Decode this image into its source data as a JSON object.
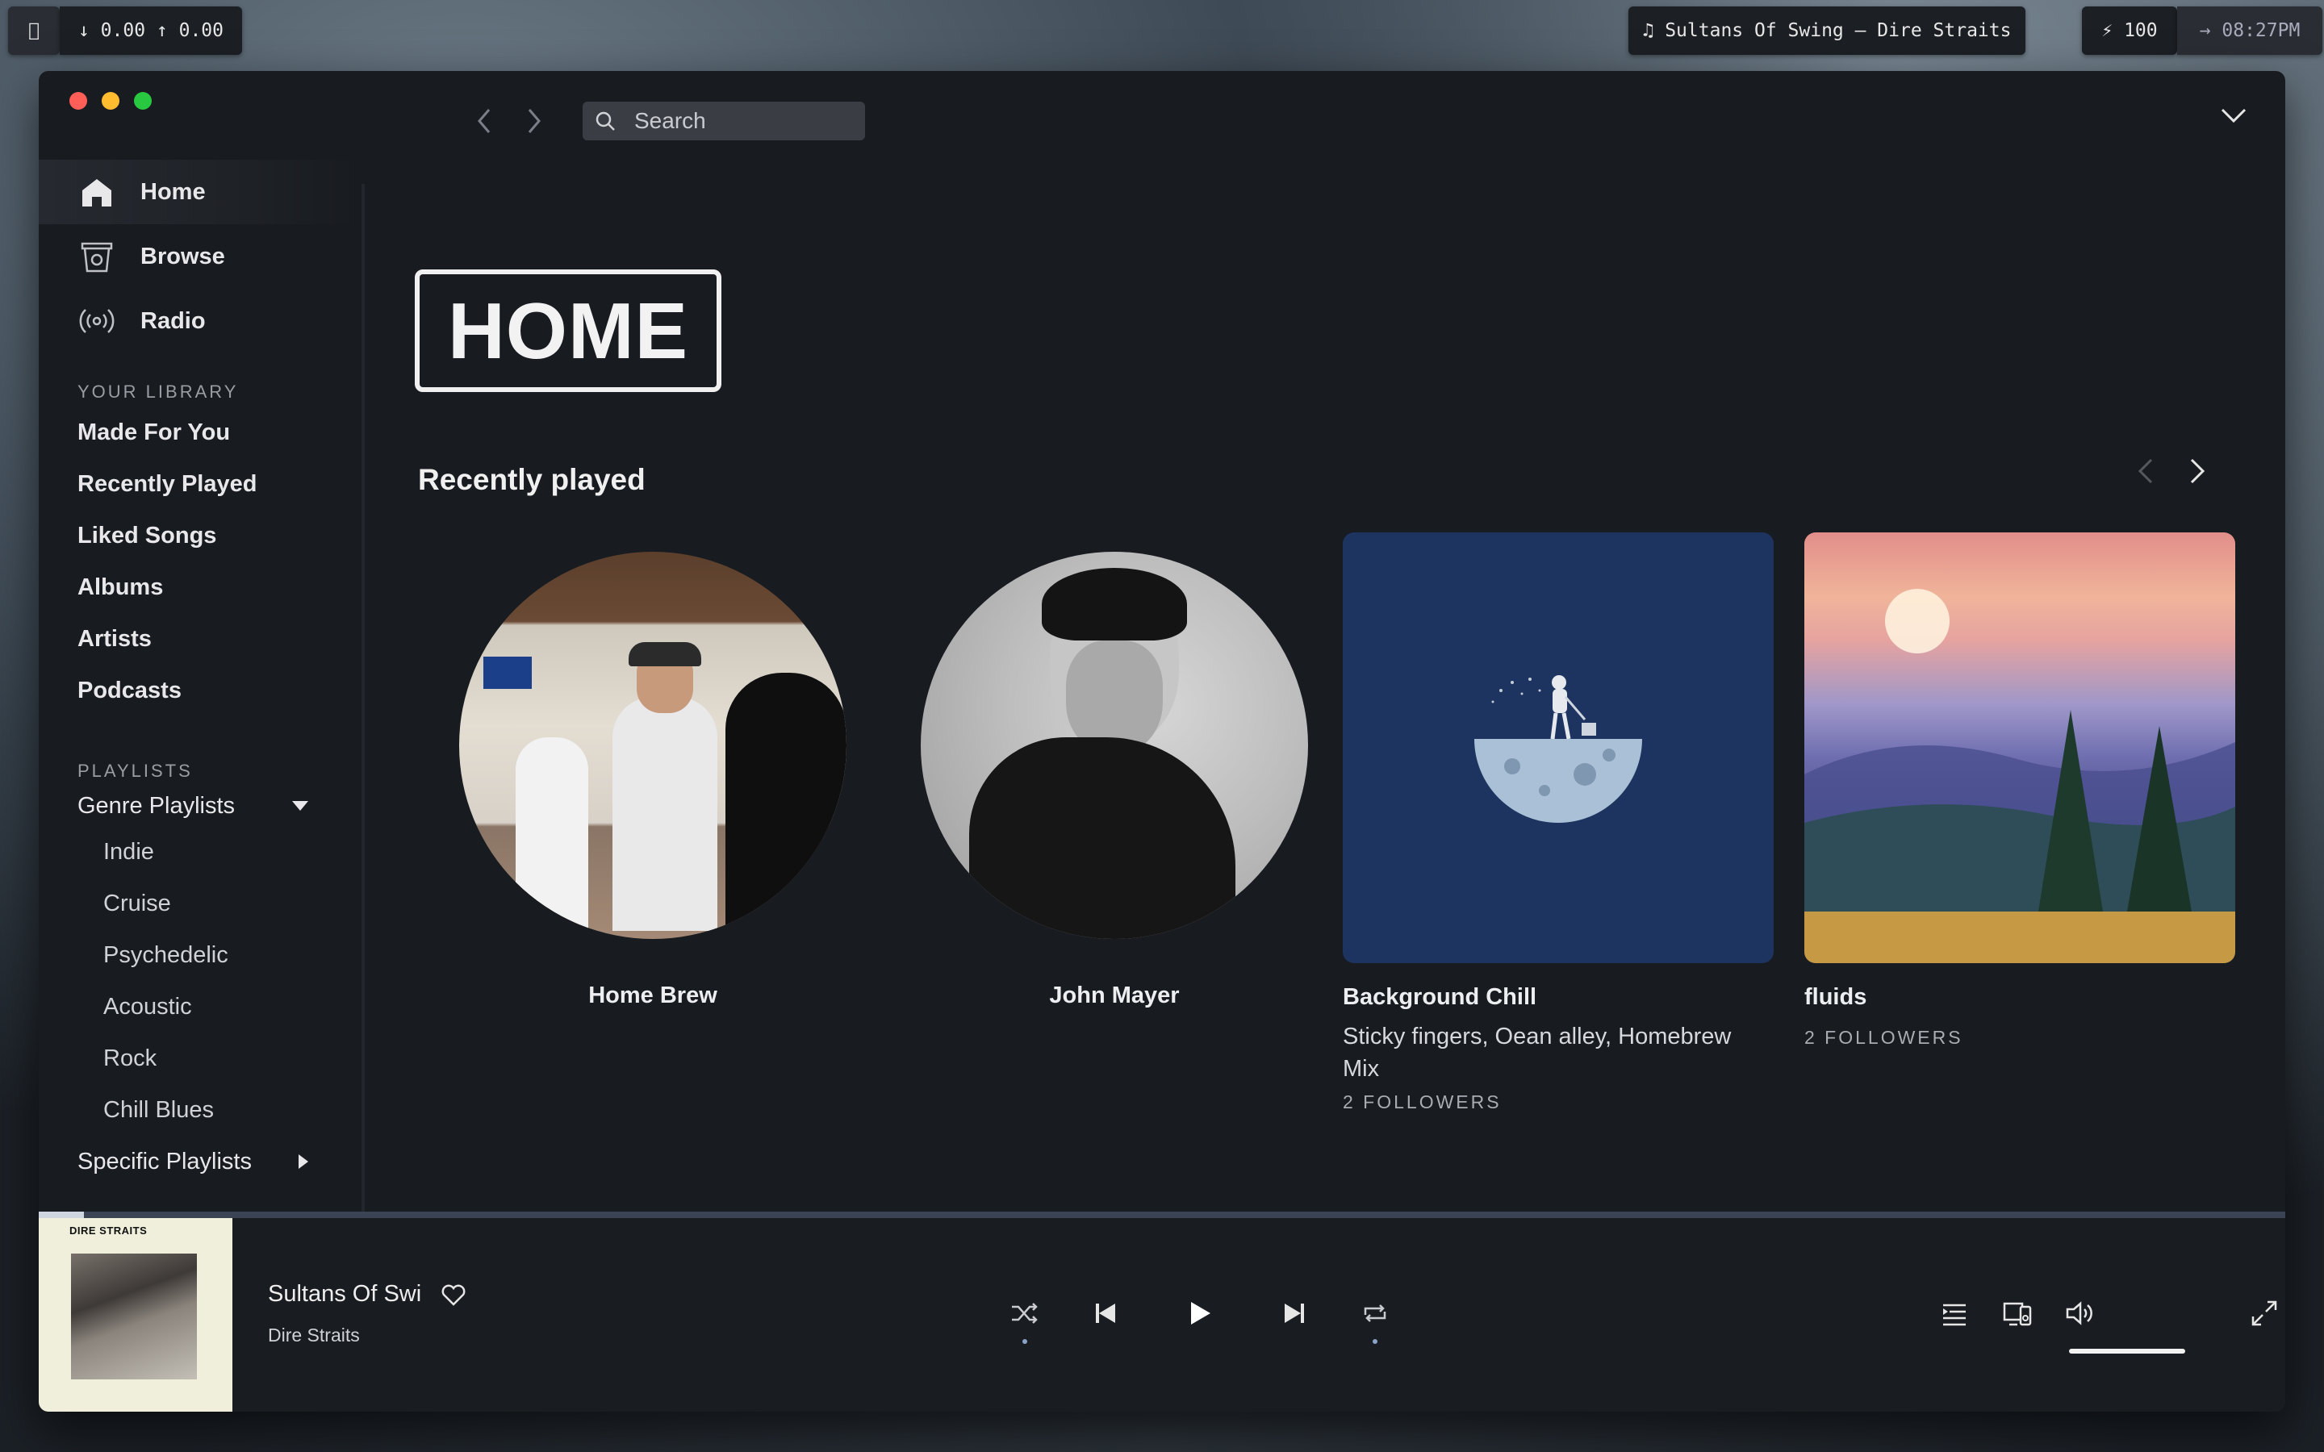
{
  "menubar": {
    "apple": "",
    "network": "↓ 0.00 ↑ 0.00",
    "now_playing": "♫ Sultans Of Swing – Dire Straits",
    "battery": "⚡ 100",
    "clock": "→ 08:27PM"
  },
  "search": {
    "placeholder": "Search"
  },
  "sidebar": {
    "nav": [
      {
        "label": "Home",
        "icon": "home-icon"
      },
      {
        "label": "Browse",
        "icon": "browse-icon"
      },
      {
        "label": "Radio",
        "icon": "radio-icon"
      }
    ],
    "library_label": "YOUR LIBRARY",
    "library": [
      "Made For You",
      "Recently Played",
      "Liked Songs",
      "Albums",
      "Artists",
      "Podcasts"
    ],
    "playlists_label": "PLAYLISTS",
    "genre_playlists": "Genre Playlists",
    "genres": [
      "Indie",
      "Cruise",
      "Psychedelic",
      "Acoustic",
      "Rock",
      "Chill Blues"
    ],
    "specific_playlists": "Specific Playlists"
  },
  "main": {
    "home_heading": "HOME",
    "recently_played": "Recently played",
    "cards": [
      {
        "title": "Home Brew",
        "shape": "circle"
      },
      {
        "title": "John Mayer",
        "shape": "circle"
      },
      {
        "title": "Background Chill",
        "subtitle": "Sticky fingers, Oean alley, Homebrew Mix",
        "meta": "2 FOLLOWERS",
        "shape": "square"
      },
      {
        "title": "fluids",
        "meta": "2 FOLLOWERS",
        "shape": "square"
      }
    ]
  },
  "player": {
    "cover_label": "DIRE STRAITS",
    "track": "Sultans Of Swi",
    "artist": "Dire Straits",
    "progress_fraction": 0.02,
    "volume_fraction": 1.0
  },
  "colors": {
    "window_bg": "#181b20",
    "sidebar_active": "#262a30",
    "accent_blue": "#8aa4c8"
  }
}
